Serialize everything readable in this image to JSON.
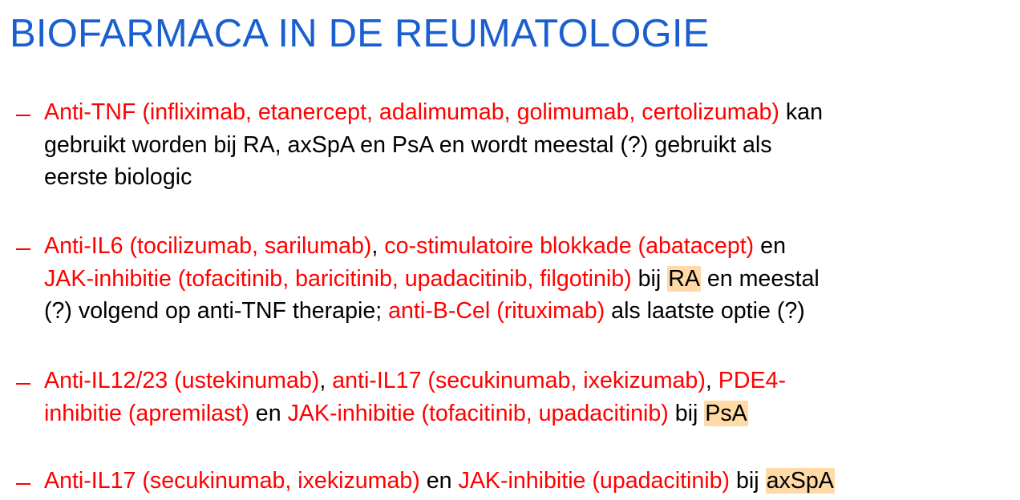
{
  "title": "BIOFARMACA IN DE REUMATOLOGIE",
  "colors": {
    "title": "#1a5fd0",
    "accent": "#ff0000",
    "highlight": "#ffd9a6"
  },
  "bullets": [
    {
      "lines": [
        [
          {
            "t": "Anti-TNF (infliximab, etanercept, adalimumab, golimumab, certolizumab)",
            "s": "red"
          },
          {
            "t": " kan",
            "s": ""
          }
        ],
        [
          {
            "t": "gebruikt worden bij RA, axSpA en PsA en wordt meestal (?) gebruikt als",
            "s": ""
          }
        ],
        [
          {
            "t": "eerste biologic",
            "s": ""
          }
        ]
      ]
    },
    {
      "lines": [
        [
          {
            "t": "Anti-IL6 (tocilizumab, sarilumab)",
            "s": "red"
          },
          {
            "t": ", ",
            "s": ""
          },
          {
            "t": "co-stimulatoire blokkade (abatacept)",
            "s": "red"
          },
          {
            "t": " en",
            "s": ""
          }
        ],
        [
          {
            "t": "JAK-inhibitie (tofacitinib, baricitinib, upadacitinib, filgotinib)",
            "s": "red"
          },
          {
            "t": " bij ",
            "s": ""
          },
          {
            "t": "RA",
            "s": "hl"
          },
          {
            "t": " en meestal",
            "s": ""
          }
        ],
        [
          {
            "t": "(?) volgend op anti-TNF therapie; ",
            "s": ""
          },
          {
            "t": "anti-B-Cel (rituximab)",
            "s": "red"
          },
          {
            "t": " als laatste optie (?)",
            "s": ""
          }
        ]
      ]
    },
    {
      "lines": [
        [
          {
            "t": "Anti-IL12/23 (ustekinumab)",
            "s": "red"
          },
          {
            "t": ", ",
            "s": ""
          },
          {
            "t": "anti-IL17 (secukinumab, ixekizumab)",
            "s": "red"
          },
          {
            "t": ", ",
            "s": ""
          },
          {
            "t": "PDE4-",
            "s": "red"
          }
        ],
        [
          {
            "t": "inhibitie (apremilast)",
            "s": "red"
          },
          {
            "t": " en ",
            "s": ""
          },
          {
            "t": "JAK-inhibitie (tofacitinib, upadacitinib)",
            "s": "red"
          },
          {
            "t": " bij ",
            "s": ""
          },
          {
            "t": "PsA",
            "s": "hl"
          }
        ]
      ]
    },
    {
      "lines": [
        [
          {
            "t": "Anti-IL17 (secukinumab, ixekizumab)",
            "s": "red"
          },
          {
            "t": " en ",
            "s": ""
          },
          {
            "t": "JAK-inhibitie (upadacitinib)",
            "s": "red"
          },
          {
            "t": " bij ",
            "s": ""
          },
          {
            "t": "axSpA",
            "s": "hl"
          }
        ]
      ]
    }
  ]
}
